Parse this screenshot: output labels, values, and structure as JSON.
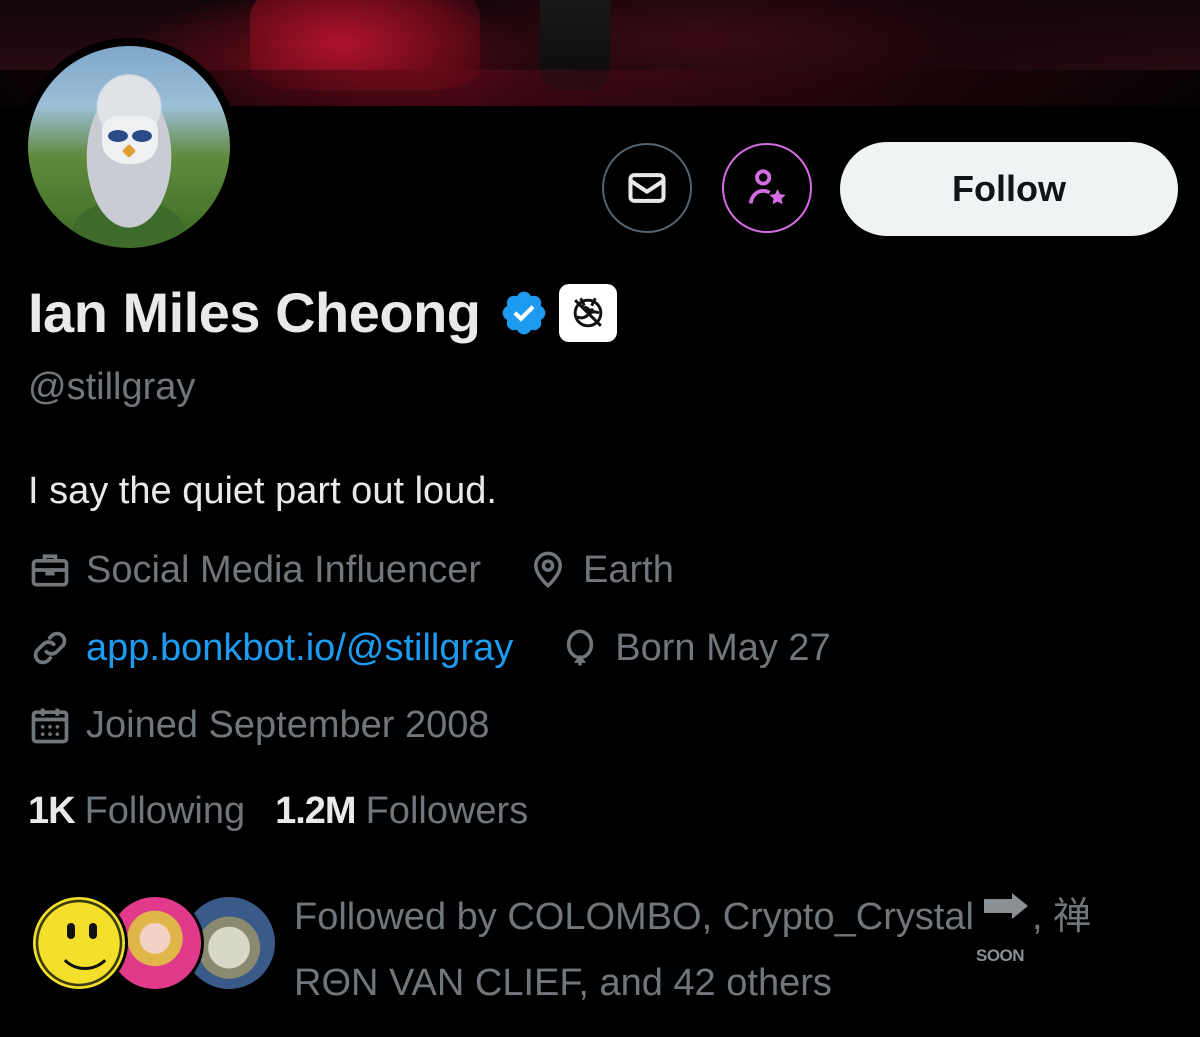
{
  "profile": {
    "name": "Ian Miles Cheong",
    "handle": "@stillgray",
    "bio": "I say the quiet part out loud.",
    "verified": true,
    "verified_color": "#1d9bf0"
  },
  "actions": {
    "message_icon": "envelope-icon",
    "subscribe_icon": "person-star-icon",
    "follow_label": "Follow"
  },
  "meta": {
    "category": "Social Media Influencer",
    "location": "Earth",
    "website": "app.bonkbot.io/@stillgray",
    "birthday": "Born May 27",
    "joined": "Joined September 2008"
  },
  "stats": {
    "following_count": "1K",
    "following_label": "Following",
    "followers_count": "1.2M",
    "followers_label": "Followers"
  },
  "followed_by": {
    "prefix": "Followed by ",
    "name1": "COLOMBO, Crypto_Crystal",
    "badge_text": "SOON",
    "name2_sep": ", 禅",
    "line2": "RΘN VAN CLIEF, and 42 others"
  },
  "colors": {
    "background": "#000000",
    "text_primary": "#e7e9ea",
    "text_secondary": "#71767b",
    "link": "#1d9bf0",
    "follow_button_bg": "#eff3f4",
    "subscribe_ring": "#d36ee0"
  }
}
